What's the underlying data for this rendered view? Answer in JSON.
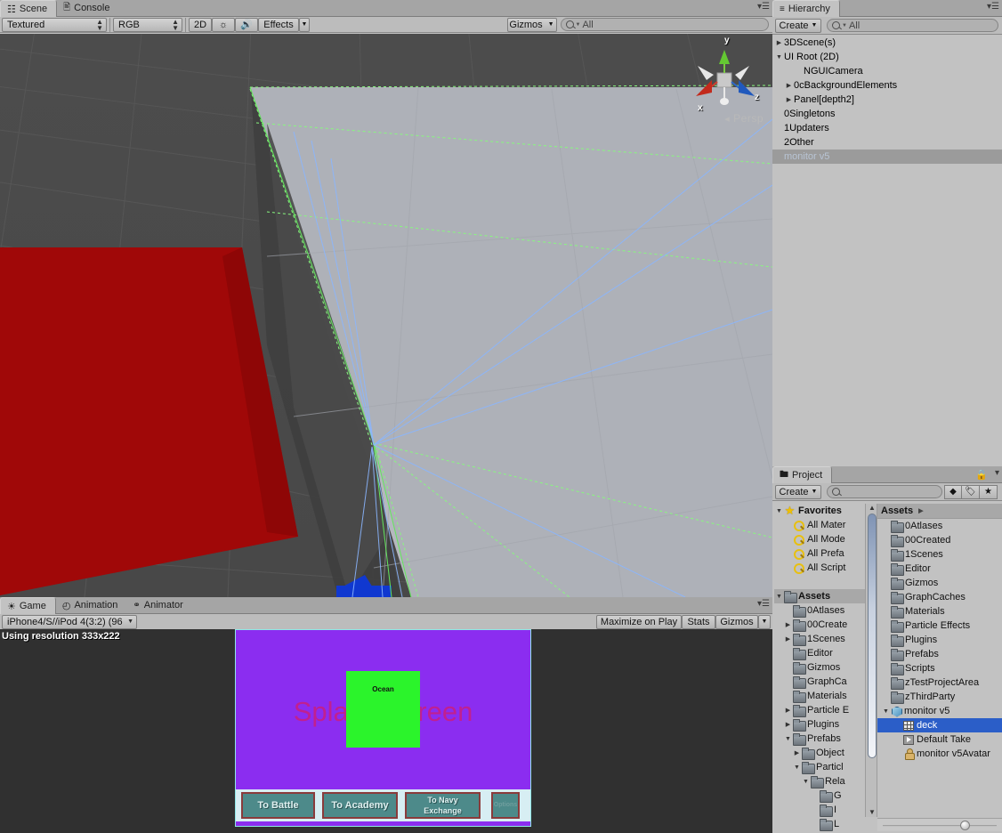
{
  "scene_panel": {
    "tabs": [
      {
        "label": "Scene",
        "icon": "grid-icon",
        "active": true
      },
      {
        "label": "Console",
        "icon": "console-icon",
        "active": false
      }
    ],
    "toolbar": {
      "draw_mode": "Textured",
      "color_mode": "RGB",
      "view_2d": "2D",
      "lighting_icon": "sun-icon",
      "audio_icon": "speaker-icon",
      "effects": "Effects",
      "gizmos": "Gizmos",
      "search_placeholder": "All",
      "search_value": "All"
    },
    "gizmo": {
      "x": "x",
      "y": "y",
      "z": "z",
      "projection": "Persp"
    }
  },
  "game_panel": {
    "tabs": [
      {
        "label": "Game",
        "icon": "gamepad-icon",
        "active": true
      },
      {
        "label": "Animation",
        "icon": "clock-icon",
        "active": false
      },
      {
        "label": "Animator",
        "icon": "animator-icon",
        "active": false
      }
    ],
    "toolbar": {
      "aspect": "iPhone4/S//iPod 4(3:2) (96(",
      "maximize_on_play": "Maximize on Play",
      "stats": "Stats",
      "gizmos": "Gizmos"
    },
    "resolution_label": "Using resolution 333x222",
    "content": {
      "background_color": "#8b2df0",
      "ocean_label": "Ocean",
      "splash_title": "Splash Screen",
      "buttons": [
        {
          "label": "To Battle",
          "id": "to-battle"
        },
        {
          "label": "To Academy",
          "id": "to-academy"
        },
        {
          "label": "To Navy\nExchange",
          "line1": "To Navy",
          "line2": "Exchange",
          "id": "to-navy-exchange"
        },
        {
          "label": "Options",
          "id": "options"
        }
      ]
    }
  },
  "hierarchy_panel": {
    "tab_label": "Hierarchy",
    "create_label": "Create",
    "search_value": "All",
    "items": [
      {
        "label": "3DScene(s)",
        "indent": 0,
        "arrow": "right",
        "selected": false
      },
      {
        "label": "UI Root (2D)",
        "indent": 0,
        "arrow": "down",
        "selected": false
      },
      {
        "label": "NGUICamera",
        "indent": 2,
        "arrow": "none",
        "selected": false
      },
      {
        "label": "0cBackgroundElements",
        "indent": 1,
        "arrow": "right",
        "selected": false
      },
      {
        "label": "Panel[depth2]",
        "indent": 1,
        "arrow": "right",
        "selected": false
      },
      {
        "label": "0Singletons",
        "indent": 0,
        "arrow": "none",
        "selected": false
      },
      {
        "label": "1Updaters",
        "indent": 0,
        "arrow": "none",
        "selected": false
      },
      {
        "label": "2Other",
        "indent": 0,
        "arrow": "none",
        "selected": false
      },
      {
        "label": "monitor v5",
        "indent": 0,
        "arrow": "none",
        "selected": true
      }
    ]
  },
  "project_panel": {
    "tab_label": "Project",
    "create_label": "Create",
    "search_value": "",
    "lock_icon": "lock-icon",
    "filter_type_icon": "shapes-filter-icon",
    "filter_label_icon": "tag-filter-icon",
    "favorite_icon": "star-icon",
    "tree": [
      {
        "label": "Favorites",
        "indent": 0,
        "arrow": "down",
        "icon": "star",
        "bold": true
      },
      {
        "label": "All Mater",
        "indent": 1,
        "arrow": "none",
        "icon": "search"
      },
      {
        "label": "All Mode",
        "indent": 1,
        "arrow": "none",
        "icon": "search"
      },
      {
        "label": "All Prefa",
        "indent": 1,
        "arrow": "none",
        "icon": "search"
      },
      {
        "label": "All Script",
        "indent": 1,
        "arrow": "none",
        "icon": "search"
      },
      {
        "label": "",
        "indent": 0,
        "arrow": "none",
        "icon": "none"
      },
      {
        "label": "Assets",
        "indent": 0,
        "arrow": "down",
        "icon": "folder",
        "bold": true,
        "header": true
      },
      {
        "label": "0Atlases",
        "indent": 1,
        "arrow": "none",
        "icon": "folder"
      },
      {
        "label": "00Create",
        "indent": 1,
        "arrow": "right",
        "icon": "folder"
      },
      {
        "label": "1Scenes",
        "indent": 1,
        "arrow": "right",
        "icon": "folder"
      },
      {
        "label": "Editor",
        "indent": 1,
        "arrow": "none",
        "icon": "folder"
      },
      {
        "label": "Gizmos",
        "indent": 1,
        "arrow": "none",
        "icon": "folder"
      },
      {
        "label": "GraphCa",
        "indent": 1,
        "arrow": "none",
        "icon": "folder"
      },
      {
        "label": "Materials",
        "indent": 1,
        "arrow": "none",
        "icon": "folder"
      },
      {
        "label": "Particle E",
        "indent": 1,
        "arrow": "right",
        "icon": "folder"
      },
      {
        "label": "Plugins",
        "indent": 1,
        "arrow": "right",
        "icon": "folder"
      },
      {
        "label": "Prefabs",
        "indent": 1,
        "arrow": "down",
        "icon": "folder"
      },
      {
        "label": "Object",
        "indent": 2,
        "arrow": "right",
        "icon": "folder"
      },
      {
        "label": "Particl",
        "indent": 2,
        "arrow": "down",
        "icon": "folder"
      },
      {
        "label": "Rela",
        "indent": 3,
        "arrow": "down",
        "icon": "folder"
      },
      {
        "label": "G",
        "indent": 4,
        "arrow": "none",
        "icon": "folder"
      },
      {
        "label": "I",
        "indent": 4,
        "arrow": "none",
        "icon": "folder"
      },
      {
        "label": "L",
        "indent": 4,
        "arrow": "none",
        "icon": "folder"
      }
    ],
    "breadcrumb": "Assets",
    "contents": [
      {
        "label": "0Atlases",
        "icon": "folder",
        "indent": 0,
        "arrow": "none",
        "selected": false
      },
      {
        "label": "00Created",
        "icon": "folder",
        "indent": 0,
        "arrow": "none",
        "selected": false
      },
      {
        "label": "1Scenes",
        "icon": "folder",
        "indent": 0,
        "arrow": "none",
        "selected": false
      },
      {
        "label": "Editor",
        "icon": "folder",
        "indent": 0,
        "arrow": "none",
        "selected": false
      },
      {
        "label": "Gizmos",
        "icon": "folder",
        "indent": 0,
        "arrow": "none",
        "selected": false
      },
      {
        "label": "GraphCaches",
        "icon": "folder",
        "indent": 0,
        "arrow": "none",
        "selected": false
      },
      {
        "label": "Materials",
        "icon": "folder",
        "indent": 0,
        "arrow": "none",
        "selected": false
      },
      {
        "label": "Particle Effects",
        "icon": "folder",
        "indent": 0,
        "arrow": "none",
        "selected": false
      },
      {
        "label": "Plugins",
        "icon": "folder",
        "indent": 0,
        "arrow": "none",
        "selected": false
      },
      {
        "label": "Prefabs",
        "icon": "folder",
        "indent": 0,
        "arrow": "none",
        "selected": false
      },
      {
        "label": "Scripts",
        "icon": "folder",
        "indent": 0,
        "arrow": "none",
        "selected": false
      },
      {
        "label": "zTestProjectArea",
        "icon": "folder",
        "indent": 0,
        "arrow": "none",
        "selected": false
      },
      {
        "label": "zThirdParty",
        "icon": "folder",
        "indent": 0,
        "arrow": "none",
        "selected": false
      },
      {
        "label": "monitor v5",
        "icon": "prefab",
        "indent": 0,
        "arrow": "down",
        "selected": false
      },
      {
        "label": "deck",
        "icon": "mesh",
        "indent": 1,
        "arrow": "none",
        "selected": true
      },
      {
        "label": "Default Take",
        "icon": "anim",
        "indent": 1,
        "arrow": "none",
        "selected": false
      },
      {
        "label": "monitor v5Avatar",
        "icon": "avatar",
        "indent": 1,
        "arrow": "none",
        "selected": false
      }
    ]
  },
  "colors": {
    "chrome": "#c2c2c2",
    "tabbar": "#a5a5a5",
    "selection_blue": "#2b5ec8",
    "selection_gray": "#9b9b9b",
    "scene_bg": "#4a4a4a",
    "game_bg": "#303030",
    "splash_purple": "#8b2df0",
    "ocean_green": "#2bf42b",
    "splash_text": "#c02090",
    "button_teal": "#4d8a8a",
    "button_border": "#8a3b3b",
    "red_quad": "#a00808",
    "blue_quad": "#1038d0",
    "wire_green": "#7dff7d",
    "wire_blue": "#8ab6ff"
  }
}
